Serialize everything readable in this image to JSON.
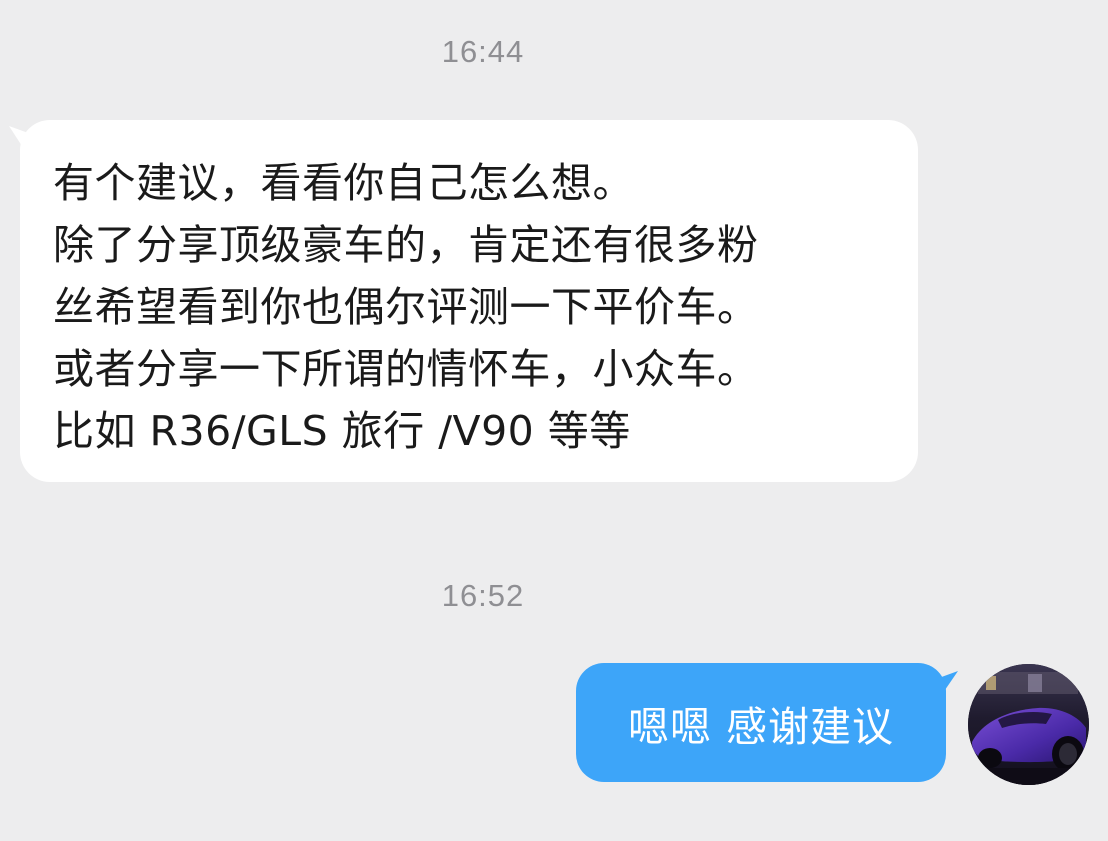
{
  "messages": [
    {
      "timestamp": "16:44",
      "direction": "incoming",
      "lines": [
        "有个建议，看看你自己怎么想。",
        "除了分享顶级豪车的，肯定还有很多粉",
        "丝希望看到你也偶尔评测一下平价车。",
        "或者分享一下所谓的情怀车，小众车。",
        "比如 R36/GLS 旅行 /V90 等等"
      ]
    },
    {
      "timestamp": "16:52",
      "direction": "outgoing",
      "text": "嗯嗯 感谢建议"
    }
  ],
  "colors": {
    "background": "#ededee",
    "incoming_bubble": "#ffffff",
    "outgoing_bubble": "#3da5f9",
    "timestamp_text": "#8f8f93"
  },
  "avatar": {
    "icon": "purple-supercar-photo-icon"
  }
}
